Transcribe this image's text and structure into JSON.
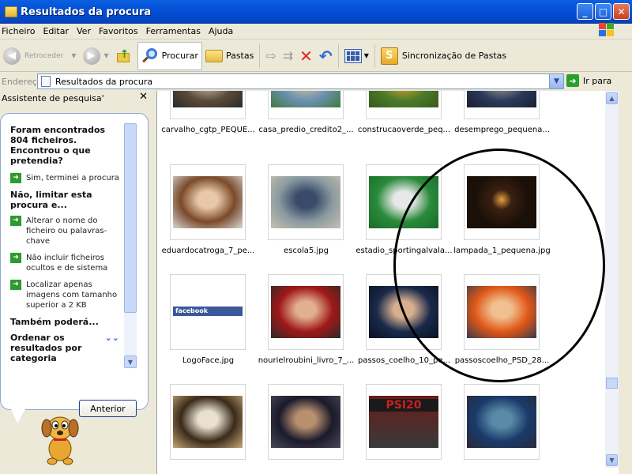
{
  "window": {
    "title": "Resultados da procura"
  },
  "title_buttons": {
    "minimize": "_",
    "maximize": "□",
    "close": "✕"
  },
  "menu": [
    "Ficheiro",
    "Editar",
    "Ver",
    "Favoritos",
    "Ferramentas",
    "Ajuda"
  ],
  "toolbar": {
    "back": "Retroceder",
    "search": "Procurar",
    "folders": "Pastas",
    "sync": "Sincronização de Pastas"
  },
  "address": {
    "label": "Endereço",
    "value": "Resultados da procura",
    "go": "Ir para"
  },
  "assistant": {
    "header": "Assistente de pesquisa'",
    "close": "✕",
    "heading": "Foram encontrados 804 ficheiros. Encontrou o que pretendia?",
    "done": "Sim, terminei a procura",
    "not_limit": "Não, limitar esta procura e...",
    "options": [
      "Alterar o nome do ficheiro ou palavras-chave",
      "Não incluir ficheiros ocultos e de sistema",
      "Localizar apenas imagens com tamanho superior a 2 KB"
    ],
    "also": "Também poderá...",
    "sort": "Ordenar os resultados por categoria",
    "back_button": "Anterior"
  },
  "files": [
    {
      "name": "carvalho_cgtp_PEQUE...",
      "colors": [
        "#5a4a3a",
        "#b8a890",
        "#2a2a2a"
      ]
    },
    {
      "name": "casa_predio_credito2_...",
      "colors": [
        "#6a8fb0",
        "#c0b8a0",
        "#3f7a3a"
      ]
    },
    {
      "name": "construcaoverde_peq...",
      "colors": [
        "#4a7a2a",
        "#c89a30",
        "#3a5a1a"
      ]
    },
    {
      "name": "desemprego_pequena...",
      "colors": [
        "#2a3a5a",
        "#8a8a8a",
        "#1a2030"
      ]
    },
    {
      "name": "eduardocatroga_7_pe...",
      "colors": [
        "#7a4a2a",
        "#e8c8a8",
        "#d8d8d8"
      ]
    },
    {
      "name": "escola5.jpg",
      "colors": [
        "#8a9aa0",
        "#3a4a6a",
        "#c8c0b0"
      ]
    },
    {
      "name": "estadio_sportingalvala...",
      "colors": [
        "#2a8a3a",
        "#e8e8e8",
        "#1a6a2a"
      ]
    },
    {
      "name": "lampada_1_pequena.jpg",
      "colors": [
        "#1a1008",
        "#e8a040",
        "#3a2010"
      ]
    },
    {
      "name": "LogoFace.jpg",
      "colors": [
        "#ffffff",
        "#3b5998",
        "#ffffff"
      ]
    },
    {
      "name": "nourielroubini_livro_7_...",
      "colors": [
        "#a01818",
        "#e0b090",
        "#2a2a2a"
      ]
    },
    {
      "name": "passos_coelho_10_pe...",
      "colors": [
        "#1a2a4a",
        "#d8b090",
        "#0a1020"
      ]
    },
    {
      "name": "passoscoelho_PSD_28...",
      "colors": [
        "#e05818",
        "#f0c090",
        "#3a3a4a"
      ]
    },
    {
      "name": "",
      "colors": [
        "#3a2a1a",
        "#e8e0d0",
        "#c8a878"
      ]
    },
    {
      "name": "",
      "colors": [
        "#1a1a2a",
        "#b89070",
        "#4a4a5a"
      ]
    },
    {
      "name": "",
      "colors": [
        "#6a1a1a",
        "#c82020",
        "#3a3a3a"
      ]
    },
    {
      "name": "",
      "colors": [
        "#1a3a6a",
        "#5a8aa8",
        "#2a2a3a"
      ]
    }
  ],
  "logo_face_text": "facebook",
  "psi_text": "PSI20"
}
